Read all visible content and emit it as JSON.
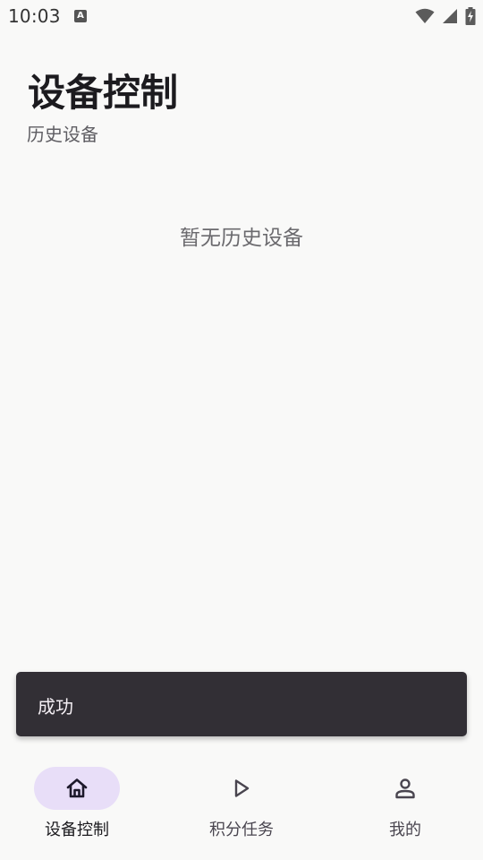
{
  "status_bar": {
    "time": "10:03",
    "notification_icon": "app-notification-icon",
    "icons": [
      "wifi-icon",
      "cellular-signal-icon",
      "battery-charging-icon"
    ]
  },
  "header": {
    "title": "设备控制",
    "section_label": "历史设备"
  },
  "main": {
    "empty_message": "暂无历史设备"
  },
  "snackbar": {
    "message": "成功"
  },
  "bottom_nav": {
    "items": [
      {
        "label": "设备控制",
        "icon": "home-icon",
        "active": true
      },
      {
        "label": "积分任务",
        "icon": "play-icon",
        "active": false
      },
      {
        "label": "我的",
        "icon": "person-icon",
        "active": false
      }
    ]
  },
  "colors": {
    "background": "#f9f9f8",
    "snackbar_bg": "#322f35",
    "nav_indicator": "#e8def8"
  }
}
